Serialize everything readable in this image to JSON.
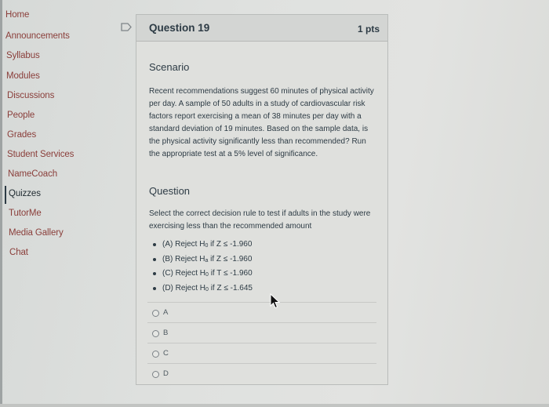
{
  "sidebar": {
    "items": [
      {
        "label": "Home",
        "active": false
      },
      {
        "label": "Announcements",
        "active": false
      },
      {
        "label": "Syllabus",
        "active": false
      },
      {
        "label": "Modules",
        "active": false
      },
      {
        "label": "Discussions",
        "active": false
      },
      {
        "label": "People",
        "active": false
      },
      {
        "label": "Grades",
        "active": false
      },
      {
        "label": "Student Services",
        "active": false
      },
      {
        "label": "NameCoach",
        "active": false
      },
      {
        "label": "Quizzes",
        "active": true
      },
      {
        "label": "TutorMe",
        "active": false
      },
      {
        "label": "Media Gallery",
        "active": false
      },
      {
        "label": "Chat",
        "active": false
      }
    ]
  },
  "question": {
    "flag_icon": "flag-outline-icon",
    "title": "Question 19",
    "points": "1 pts",
    "scenario_heading": "Scenario",
    "scenario_text": "Recent recommendations suggest 60 minutes of physical activity per day. A sample of 50 adults in a study of cardiovascular risk factors report exercising a mean of 38 minutes per day with a standard deviation of 19 minutes. Based on the sample data, is the physical activity significantly less than recommended? Run the appropriate test at a 5% level of significance.",
    "question_heading": "Question",
    "question_text": "Select the correct decision rule to test if adults in the study were exercising less than the recommended amount",
    "rules": [
      {
        "prefix": "(A) Reject H",
        "sub": "0",
        "suffix": " if Z ≤ -1.960"
      },
      {
        "prefix": "(B) Reject H",
        "sub": "a",
        "suffix": " if Z ≤ -1.960"
      },
      {
        "prefix": "(C) Reject H",
        "sub": "0",
        "suffix": " if T ≤ -1.960"
      },
      {
        "prefix": "(D) Reject H",
        "sub": "0",
        "suffix": " if Z ≤ -1.645"
      }
    ],
    "answers": [
      {
        "label": "A",
        "selected": false
      },
      {
        "label": "B",
        "selected": false
      },
      {
        "label": "C",
        "selected": false
      },
      {
        "label": "D",
        "selected": false
      }
    ]
  },
  "colors": {
    "nav_link": "#8a3e3a",
    "text": "#2d3b45"
  }
}
